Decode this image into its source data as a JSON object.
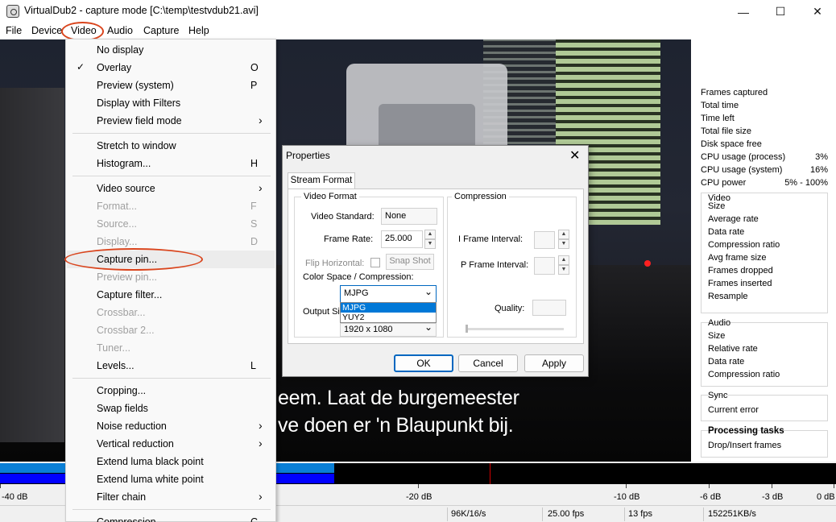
{
  "window": {
    "title": "VirtualDub2  - capture mode [C:\\temp\\testvdub21.avi]",
    "minimize": "—",
    "maximize": "☐",
    "close": "✕"
  },
  "menubar": [
    "File",
    "Device",
    "Video",
    "Audio",
    "Capture",
    "Help"
  ],
  "video_menu": {
    "items": [
      {
        "label": "No display",
        "shortcut": "",
        "submenu": false,
        "checked": false,
        "disabled": false
      },
      {
        "label": "Overlay",
        "shortcut": "O",
        "submenu": false,
        "checked": true,
        "disabled": false
      },
      {
        "label": "Preview (system)",
        "shortcut": "P",
        "submenu": false,
        "checked": false,
        "disabled": false
      },
      {
        "label": "Display with Filters",
        "shortcut": "",
        "submenu": false,
        "checked": false,
        "disabled": false
      },
      {
        "label": "Preview field mode",
        "shortcut": "",
        "submenu": true,
        "checked": false,
        "disabled": false
      },
      {
        "label": "Stretch to window",
        "shortcut": "",
        "submenu": false,
        "checked": false,
        "disabled": false
      },
      {
        "label": "Histogram...",
        "shortcut": "H",
        "submenu": false,
        "checked": false,
        "disabled": false
      },
      {
        "label": "Video source",
        "shortcut": "",
        "submenu": true,
        "checked": false,
        "disabled": false
      },
      {
        "label": "Format...",
        "shortcut": "F",
        "submenu": false,
        "checked": false,
        "disabled": true
      },
      {
        "label": "Source...",
        "shortcut": "S",
        "submenu": false,
        "checked": false,
        "disabled": true
      },
      {
        "label": "Display...",
        "shortcut": "D",
        "submenu": false,
        "checked": false,
        "disabled": true
      },
      {
        "label": "Capture pin...",
        "shortcut": "",
        "submenu": false,
        "checked": false,
        "disabled": false
      },
      {
        "label": "Preview pin...",
        "shortcut": "",
        "submenu": false,
        "checked": false,
        "disabled": true
      },
      {
        "label": "Capture filter...",
        "shortcut": "",
        "submenu": false,
        "checked": false,
        "disabled": false
      },
      {
        "label": "Crossbar...",
        "shortcut": "",
        "submenu": false,
        "checked": false,
        "disabled": true
      },
      {
        "label": "Crossbar 2...",
        "shortcut": "",
        "submenu": false,
        "checked": false,
        "disabled": true
      },
      {
        "label": "Tuner...",
        "shortcut": "",
        "submenu": false,
        "checked": false,
        "disabled": true
      },
      {
        "label": "Levels...",
        "shortcut": "L",
        "submenu": false,
        "checked": false,
        "disabled": false
      },
      {
        "label": "Cropping...",
        "shortcut": "",
        "submenu": false,
        "checked": false,
        "disabled": false
      },
      {
        "label": "Swap fields",
        "shortcut": "",
        "submenu": false,
        "checked": false,
        "disabled": false
      },
      {
        "label": "Noise reduction",
        "shortcut": "",
        "submenu": true,
        "checked": false,
        "disabled": false
      },
      {
        "label": "Vertical reduction",
        "shortcut": "",
        "submenu": true,
        "checked": false,
        "disabled": false
      },
      {
        "label": "Extend luma black point",
        "shortcut": "",
        "submenu": false,
        "checked": false,
        "disabled": false
      },
      {
        "label": "Extend luma white point",
        "shortcut": "",
        "submenu": false,
        "checked": false,
        "disabled": false
      },
      {
        "label": "Filter chain",
        "shortcut": "",
        "submenu": true,
        "checked": false,
        "disabled": false
      },
      {
        "label": "Compression...",
        "shortcut": "C",
        "submenu": false,
        "checked": false,
        "disabled": false
      }
    ]
  },
  "video": {
    "subtitle_line1": "eem. Laat de burgemeester",
    "subtitle_line2": "ve doen er 'n Blaupunkt bij."
  },
  "stats": {
    "rows": [
      {
        "label": "Frames captured",
        "value": ""
      },
      {
        "label": "Total time",
        "value": ""
      },
      {
        "label": "Time left",
        "value": ""
      },
      {
        "label": "Total file size",
        "value": ""
      },
      {
        "label": "Disk space free",
        "value": ""
      },
      {
        "label": "CPU usage (process)",
        "value": "3%"
      },
      {
        "label": "CPU usage (system)",
        "value": "16%"
      },
      {
        "label": "CPU power",
        "value": "5% - 100%"
      }
    ],
    "video_group": {
      "title": "Video",
      "items": [
        "Size",
        "Average rate",
        "Data rate",
        "Compression ratio",
        "Avg frame size",
        "Frames dropped",
        "Frames inserted",
        "Resample"
      ]
    },
    "audio_group": {
      "title": "Audio",
      "items": [
        "Size",
        "Relative rate",
        "Data rate",
        "Compression ratio"
      ]
    },
    "sync_group": {
      "title": "Sync",
      "items": [
        "Current error"
      ]
    },
    "processing_group": {
      "title": "Processing tasks",
      "items": [
        "Drop/Insert frames"
      ]
    }
  },
  "meter": {
    "labels": [
      "-40 dB",
      "-20 dB",
      "-10 dB",
      "-6 dB",
      "-3 dB",
      "0 dB"
    ],
    "level_fraction": 0.4,
    "colors": {
      "top_bar": "#0a7fd6",
      "bottom_bar": "#0000ff",
      "peak": "#d00000"
    }
  },
  "statusbar": {
    "cells": [
      "96K/16/s",
      "25.00 fps",
      "13 fps",
      "152251KB/s"
    ]
  },
  "properties": {
    "title": "Properties",
    "close": "✕",
    "tab": "Stream Format",
    "video_format_legend": "Video Format",
    "video_standard_label": "Video Standard:",
    "video_standard_value": "None",
    "frame_rate_label": "Frame Rate:",
    "frame_rate_value": "25.000",
    "flip_horizontal_label": "Flip Horizontal:",
    "snap_shot": "Snap Shot",
    "color_space_label": "Color Space / Compression:",
    "color_space_value": "MJPG",
    "color_space_options": [
      "MJPG",
      "YUY2"
    ],
    "output_size_label": "Output Si",
    "output_size_value": "1920 x 1080",
    "compression_legend": "Compression",
    "i_frame_label": "I Frame Interval:",
    "p_frame_label": "P Frame Interval:",
    "quality_label": "Quality:",
    "ok": "OK",
    "cancel": "Cancel",
    "apply": "Apply"
  },
  "icons": {
    "check": "✓",
    "submenu_arrow": "›",
    "dropdown_arrow": "⌄",
    "spin_up": "▲",
    "spin_down": "▼"
  }
}
